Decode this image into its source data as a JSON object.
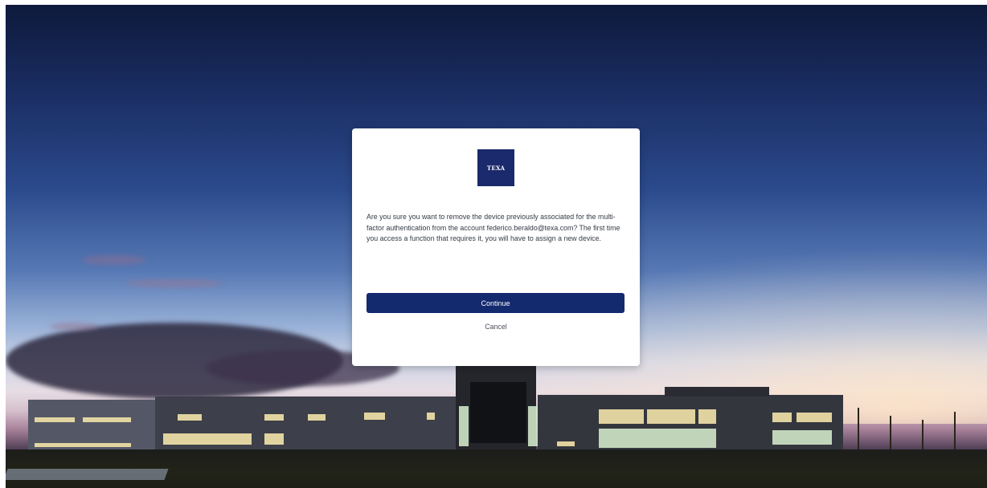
{
  "dialog": {
    "logo_text": "TEXA",
    "message": "Are you sure you want to remove the device previously associated for the multi-factor authentication from the account federico.beraldo@texa.com? The first time you access a function that requires it, you will have to assign a new device.",
    "continue_label": "Continue",
    "cancel_label": "Cancel"
  },
  "colors": {
    "brand_navy": "#142a6f",
    "dialog_bg": "#ffffff"
  },
  "icons": {
    "logo": "texa-logo"
  }
}
